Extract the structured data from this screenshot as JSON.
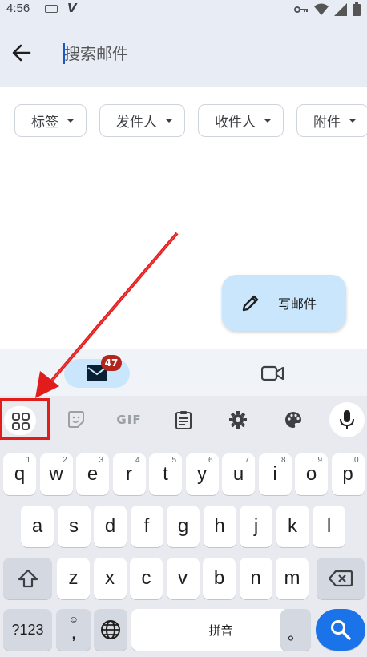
{
  "status_bar": {
    "time": "4:56",
    "icons": [
      "keyboard-icon",
      "v-icon",
      "vpn-key-icon",
      "wifi-icon",
      "signal-icon",
      "battery-icon"
    ]
  },
  "search": {
    "placeholder": "搜索邮件",
    "back_icon": "arrow-left-icon"
  },
  "filters": [
    {
      "label": "标签"
    },
    {
      "label": "发件人"
    },
    {
      "label": "收件人"
    },
    {
      "label": "附件"
    }
  ],
  "fab": {
    "label": "写邮件",
    "icon": "pencil-icon"
  },
  "bottom_nav": {
    "mail_badge": "47",
    "items": [
      "mail-icon",
      "video-camera-icon"
    ]
  },
  "keyboard": {
    "toolbar": [
      "apps-grid-icon",
      "sticker-icon",
      "GIF",
      "clipboard-icon",
      "gear-icon",
      "palette-icon",
      "mic-icon"
    ],
    "gif_label": "GIF",
    "row1": [
      {
        "k": "q",
        "h": "1"
      },
      {
        "k": "w",
        "h": "2"
      },
      {
        "k": "e",
        "h": "3"
      },
      {
        "k": "r",
        "h": "4"
      },
      {
        "k": "t",
        "h": "5"
      },
      {
        "k": "y",
        "h": "6"
      },
      {
        "k": "u",
        "h": "7"
      },
      {
        "k": "i",
        "h": "8"
      },
      {
        "k": "o",
        "h": "9"
      },
      {
        "k": "p",
        "h": "0"
      }
    ],
    "row2": [
      "a",
      "s",
      "d",
      "f",
      "g",
      "h",
      "j",
      "k",
      "l"
    ],
    "row3": [
      "z",
      "x",
      "c",
      "v",
      "b",
      "n",
      "m"
    ],
    "symbols_label": "?123",
    "comma_label": ",",
    "space_label": "拼音",
    "period_label": "。"
  },
  "colors": {
    "header_bg": "#e8edf5",
    "fab_bg": "#c9e6fc",
    "badge": "#b3261e",
    "enter_key": "#1a73e8",
    "annotation": "#e21b1b"
  }
}
